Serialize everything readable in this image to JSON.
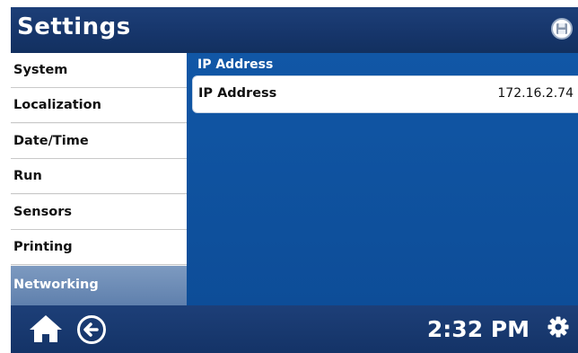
{
  "header": {
    "title": "Settings",
    "save_icon": "floppy-disk-icon"
  },
  "sidebar": {
    "items": [
      {
        "label": "System",
        "active": false
      },
      {
        "label": "Localization",
        "active": false
      },
      {
        "label": "Date/Time",
        "active": false
      },
      {
        "label": "Run",
        "active": false
      },
      {
        "label": "Sensors",
        "active": false
      },
      {
        "label": "Printing",
        "active": false
      },
      {
        "label": "Networking",
        "active": true
      }
    ]
  },
  "main": {
    "section_title": "IP Address",
    "rows": [
      {
        "label": "IP Address",
        "value": "172.16.2.74"
      }
    ]
  },
  "footer": {
    "time": "2:32 PM",
    "icons": [
      "home-icon",
      "back-arrow-icon",
      "gear-icon"
    ]
  },
  "colors": {
    "header_bg": "#1a3a72",
    "content_bg": "#0f53a0",
    "active_item": "#6f8cb6",
    "text_dark": "#111111"
  }
}
